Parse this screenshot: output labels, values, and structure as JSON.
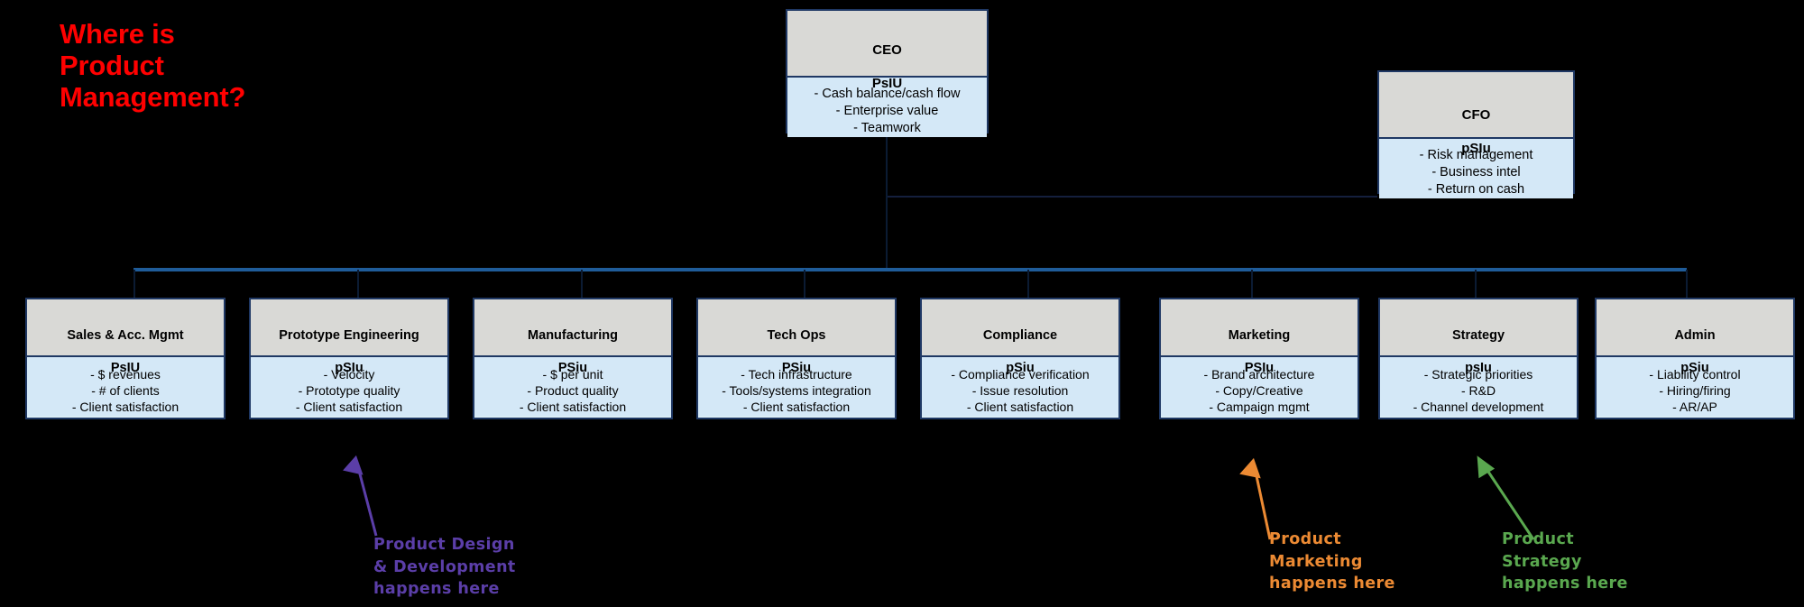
{
  "title": {
    "text": "Where is\nProduct\nManagement?",
    "color": "#ff0000"
  },
  "executives": [
    {
      "id": "ceo",
      "title": "CEO",
      "code": "PsIU",
      "metrics": "- Cash balance/cash flow\n- Enterprise value\n- Teamwork"
    },
    {
      "id": "cfo",
      "title": "CFO",
      "code": "pSIu",
      "metrics": "- Risk management\n- Business intel\n- Return on cash"
    }
  ],
  "units": [
    {
      "id": "sales",
      "title": "Sales & Acc. Mgmt",
      "code": "PsIU",
      "metrics": "- $ revenues\n- # of clients\n- Client satisfaction"
    },
    {
      "id": "prototype-engineering",
      "title": "Prototype Engineering",
      "code": "pSIu",
      "metrics": "- Velocity\n- Prototype quality\n- Client satisfaction"
    },
    {
      "id": "manufacturing",
      "title": "Manufacturing",
      "code": "PSiu",
      "metrics": "- $ per unit\n- Product  quality\n- Client satisfaction"
    },
    {
      "id": "tech-ops",
      "title": "Tech Ops",
      "code": "PSiu",
      "metrics": "- Tech infrastructure\n- Tools/systems integration\n- Client satisfaction"
    },
    {
      "id": "compliance",
      "title": "Compliance",
      "code": "pSiu",
      "metrics": "- Compliance verification\n- Issue resolution\n- Client satisfaction"
    },
    {
      "id": "marketing",
      "title": "Marketing",
      "code": "PSIu",
      "metrics": "- Brand architecture\n- Copy/Creative\n- Campaign mgmt"
    },
    {
      "id": "strategy",
      "title": "Strategy",
      "code": "psIu",
      "metrics": "- Strategic priorities\n- R&D\n- Channel development"
    },
    {
      "id": "admin",
      "title": "Admin",
      "code": "pSiu",
      "metrics": "- Liability control\n- Hiring/firing\n- AR/AP"
    }
  ],
  "annotations": [
    {
      "id": "product-design-development",
      "text": "Product  Design\n& Development\nhappens here",
      "color": "#5b3ea8"
    },
    {
      "id": "product-marketing",
      "text": "Product\nMarketing\nhappens here",
      "color": "#ec8a33"
    },
    {
      "id": "product-strategy",
      "text": "Product\nStrategy\nhappens here",
      "color": "#5aa84f"
    }
  ],
  "theme": {
    "background": "#000000",
    "box_header_fill": "#d9d9d6",
    "box_body_fill": "#d4e8f7",
    "box_border": "#1f3864",
    "connector": "#1f5c99"
  }
}
